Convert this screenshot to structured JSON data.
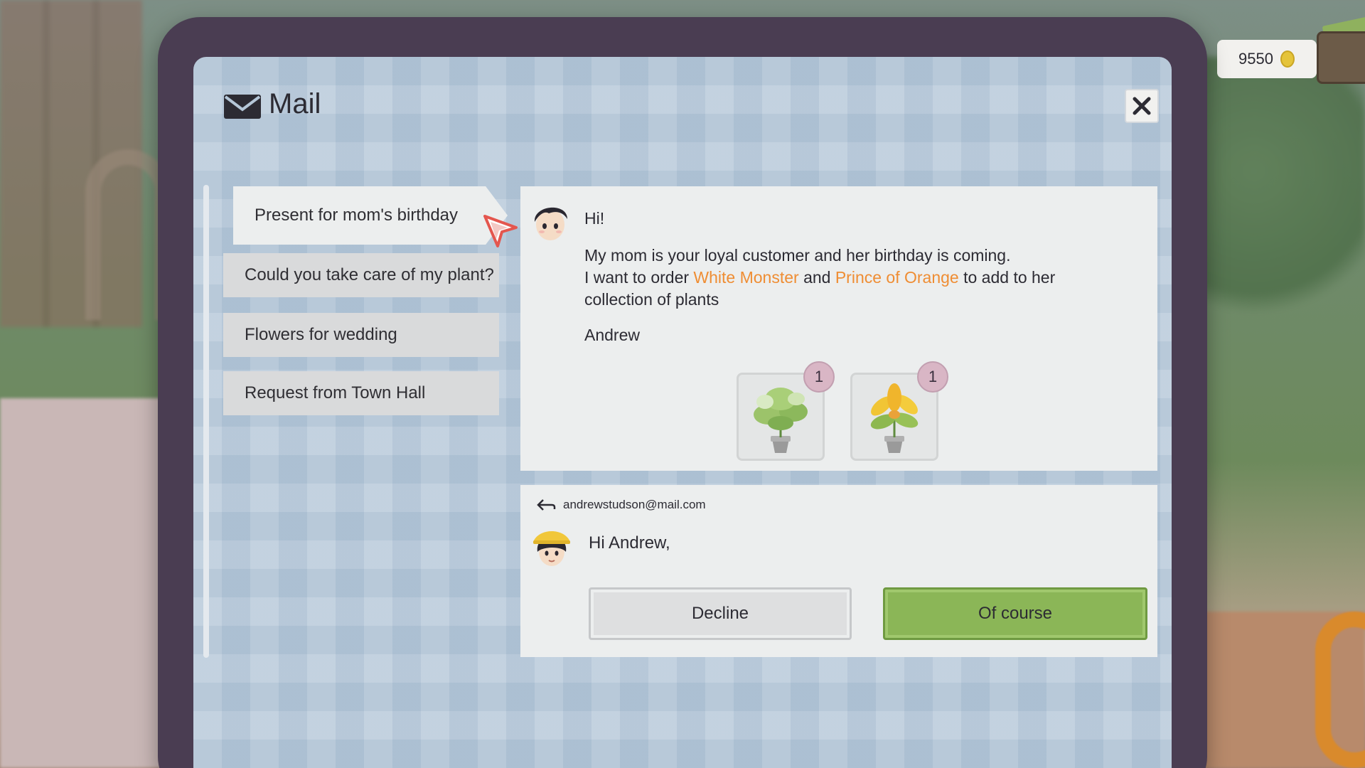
{
  "hud": {
    "coins": "9550"
  },
  "mail": {
    "title": "Mail",
    "list": [
      {
        "subject": "Present for mom's birthday"
      },
      {
        "subject": "Could you take care of my plant?"
      },
      {
        "subject": "Flowers for wedding"
      },
      {
        "subject": "Request from Town Hall"
      }
    ],
    "message": {
      "greeting": "Hi!",
      "line1": "My mom is your loyal customer and her birthday is coming.",
      "line2_pre": "I want to order ",
      "item1": "White Monster",
      "line2_mid": " and ",
      "item2": "Prince of Orange",
      "line2_post": " to add to her",
      "line3": "collection of plants",
      "signature": "Andrew",
      "plants": [
        {
          "qty": "1",
          "icon": "white-monster-plant-icon"
        },
        {
          "qty": "1",
          "icon": "prince-of-orange-plant-icon"
        }
      ]
    },
    "reply": {
      "email": "andrewstudson@mail.com",
      "greeting": "Hi Andrew,",
      "decline_label": "Decline",
      "accept_label": "Of course"
    }
  },
  "colors": {
    "highlight": "#ef8d33",
    "accept_button": "#8bb657",
    "tablet_frame": "#4a3d52"
  }
}
